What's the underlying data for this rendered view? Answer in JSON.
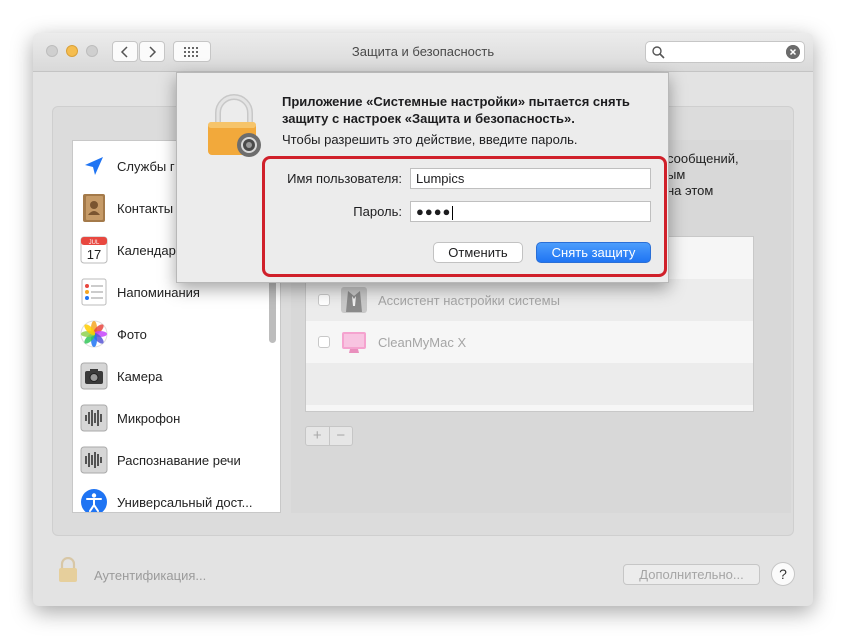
{
  "window": {
    "title": "Защита и безопасность"
  },
  "sidebar": {
    "items": [
      {
        "label": "Службы г",
        "icon": "location-arrow-icon"
      },
      {
        "label": "Контакты",
        "icon": "contacts-book-icon"
      },
      {
        "label": "Календар",
        "icon": "calendar-icon",
        "day": "17",
        "month": "JUL"
      },
      {
        "label": "Напоминания",
        "icon": "reminders-icon"
      },
      {
        "label": "Фото",
        "icon": "photos-icon"
      },
      {
        "label": "Камера",
        "icon": "camera-icon"
      },
      {
        "label": "Микрофон",
        "icon": "microphone-waveform-icon"
      },
      {
        "label": "Распознавание речи",
        "icon": "speech-waveform-icon"
      },
      {
        "label": "Универсальный дост...",
        "icon": "accessibility-icon"
      }
    ]
  },
  "right_text": "сообщений,\nым\nна этом",
  "apps": [
    {
      "name": "Ассистент настройки системы",
      "icon": "setup-assistant-icon"
    },
    {
      "name": "CleanMyMac X",
      "icon": "cleanmymac-icon"
    }
  ],
  "plus_label": "+",
  "minus_label": "−",
  "auth_label": "Аутентификация...",
  "advanced_label": "Дополнительно...",
  "help_label": "?",
  "dialog": {
    "title": "Приложение «Системные настройки» пытается снять защиту с настроек «Защита и безопасность».",
    "body": "Чтобы разрешить это действие, введите пароль.",
    "username_label": "Имя пользователя:",
    "username_value": "Lumpics",
    "password_label": "Пароль:",
    "password_mask": "●●●●",
    "cancel_label": "Отменить",
    "unlock_label": "Снять защиту"
  },
  "colors": {
    "accent": "#1f74f3",
    "highlight": "#d0202a",
    "lock": "#f2a93b"
  }
}
